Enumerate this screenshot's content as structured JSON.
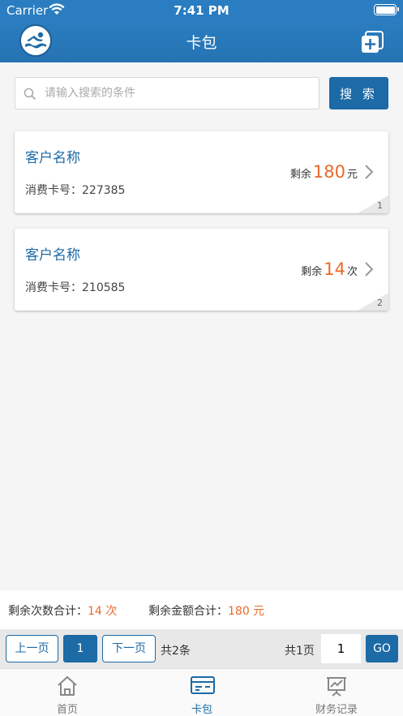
{
  "status_bar": {
    "carrier": "Carrier",
    "time": "7:41 PM"
  },
  "nav": {
    "title": "卡包"
  },
  "search": {
    "placeholder": "请输入搜索的条件",
    "button_label": "搜 索"
  },
  "cards": [
    {
      "name": "客户名称",
      "card_no_label": "消费卡号：",
      "card_no": "227385",
      "remain_label": "剩余",
      "remain_value": "180",
      "remain_unit": "元",
      "index": "1"
    },
    {
      "name": "客户名称",
      "card_no_label": "消费卡号：",
      "card_no": "210585",
      "remain_label": "剩余",
      "remain_value": "14",
      "remain_unit": "次",
      "index": "2"
    }
  ],
  "totals": {
    "count_label": "剩余次数合计：",
    "count_value": "14 次",
    "amount_label": "剩余金额合计：",
    "amount_value": "180 元"
  },
  "pager": {
    "prev_label": "上一页",
    "current_page": "1",
    "next_label": "下一页",
    "total_items": "共2条",
    "total_pages": "共1页",
    "page_input_value": "1",
    "go_label": "GO"
  },
  "tabs": [
    {
      "label": "首页",
      "icon": "home-icon",
      "active": false
    },
    {
      "label": "卡包",
      "icon": "card-icon",
      "active": true
    },
    {
      "label": "财务记录",
      "icon": "finance-chart-icon",
      "active": false
    }
  ],
  "colors": {
    "primary": "#1c6aa6",
    "nav_bg": "#2a7dc0",
    "accent": "#e8692a"
  }
}
